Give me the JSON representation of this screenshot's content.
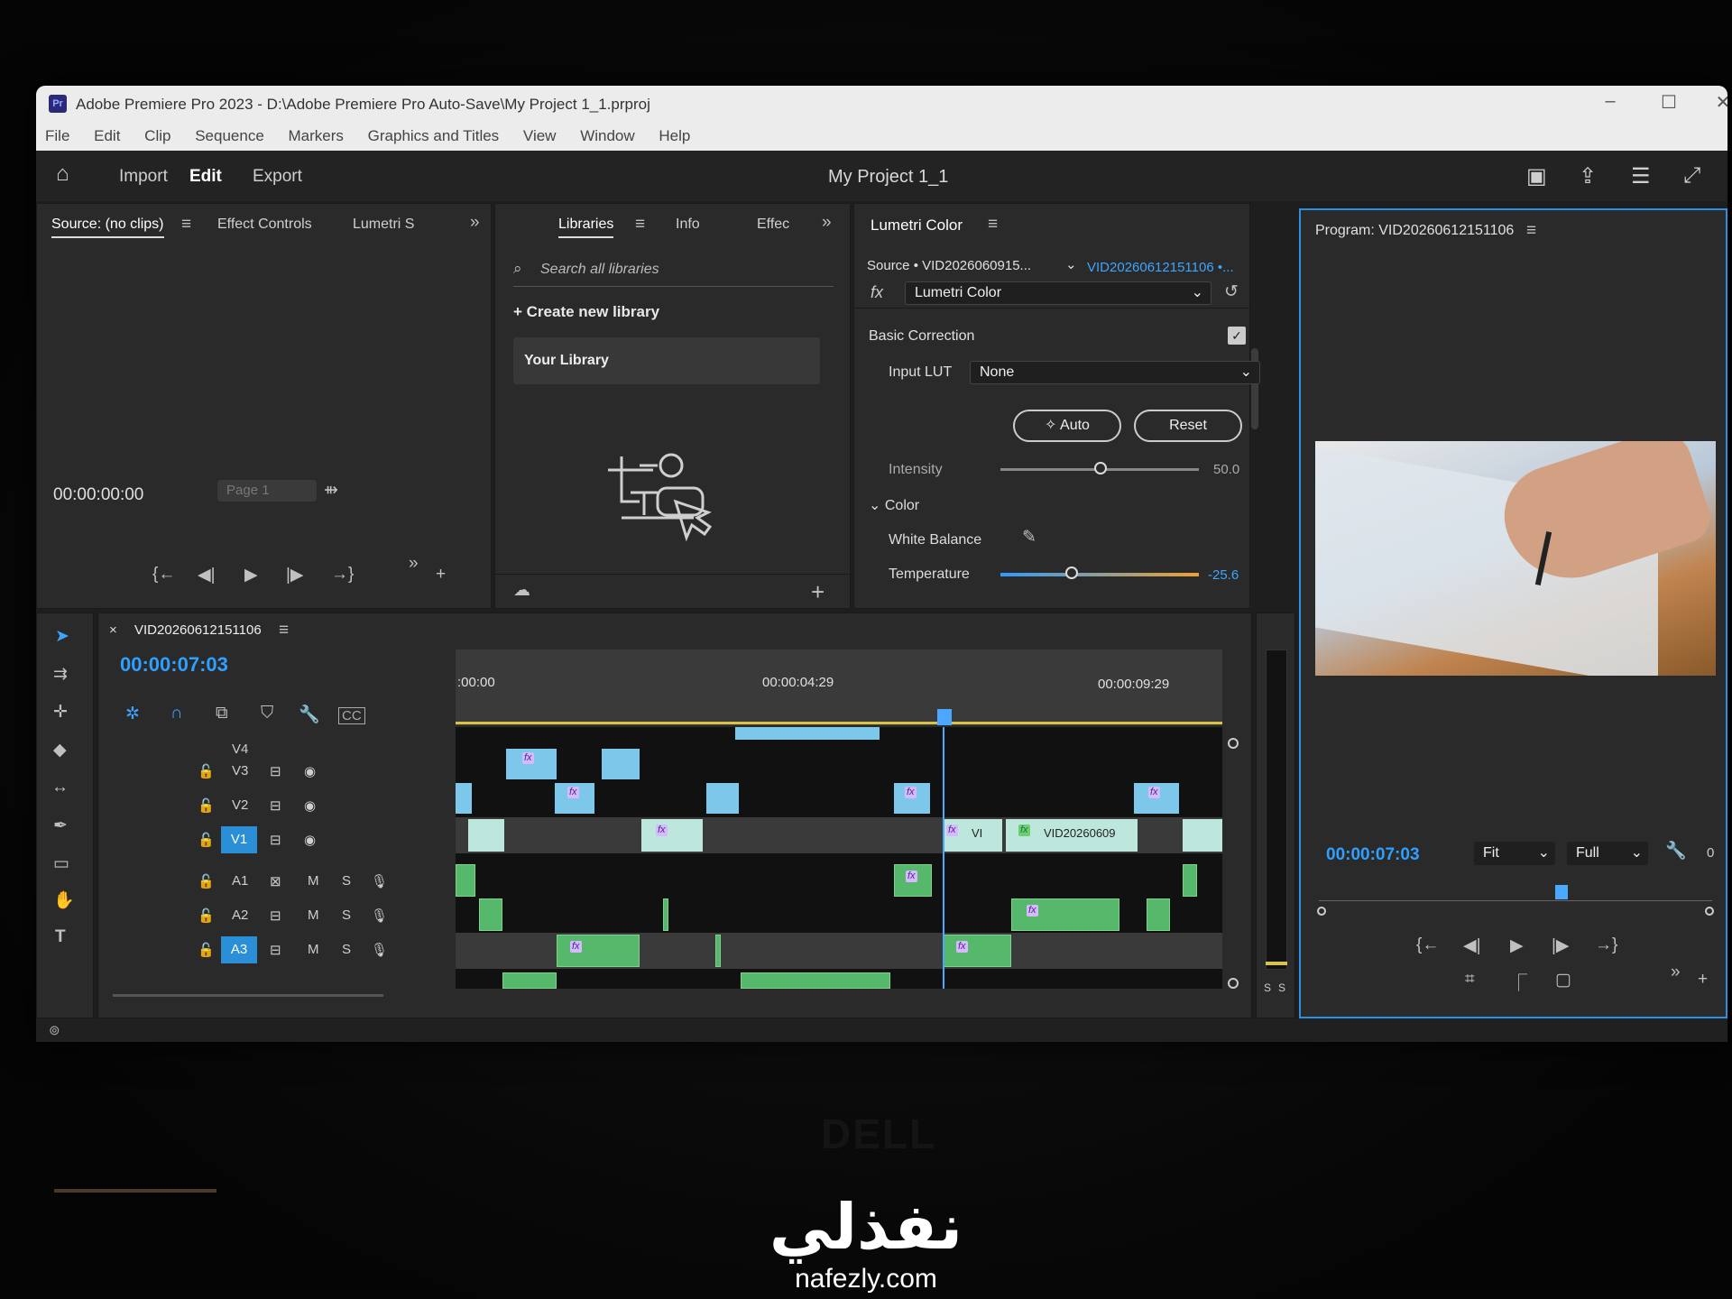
{
  "window": {
    "app_badge": "Pr",
    "title": "Adobe Premiere Pro 2023 - D:\\Adobe Premiere Pro Auto-Save\\My Project 1_1.prproj"
  },
  "menu": [
    "File",
    "Edit",
    "Clip",
    "Sequence",
    "Markers",
    "Graphics and Titles",
    "View",
    "Window",
    "Help"
  ],
  "header": {
    "home_icon": "home-icon",
    "tabs": [
      "Import",
      "Edit",
      "Export"
    ],
    "active_tab": "Edit",
    "project_title": "My Project 1_1"
  },
  "source_panel": {
    "tabs": [
      "Source: (no clips)",
      "Effect Controls",
      "Lumetri S"
    ],
    "timecode": "00:00:00:00",
    "page": "Page 1"
  },
  "libraries_panel": {
    "tabs": [
      "Libraries",
      "Info",
      "Effec"
    ],
    "search_placeholder": "Search all libraries",
    "create_label": "Create new library",
    "your_library": "Your Library"
  },
  "lumetri_panel": {
    "title": "Lumetri Color",
    "source_label": "Source • VID2026060915...",
    "clip_label": "VID20260612151106 •...",
    "fx_label": "fx",
    "effect_select": "Lumetri Color",
    "basic_correction": "Basic Correction",
    "input_lut_label": "Input LUT",
    "input_lut_value": "None",
    "auto_label": "Auto",
    "reset_label": "Reset",
    "intensity_label": "Intensity",
    "intensity_value": "50.0",
    "color_label": "Color",
    "white_balance_label": "White Balance",
    "temperature_label": "Temperature",
    "temperature_value": "-25.6"
  },
  "program_panel": {
    "title": "Program: VID20260612151106",
    "timecode": "00:00:07:03",
    "fit": "Fit",
    "full": "Full",
    "trailing": "0"
  },
  "timeline": {
    "sequence_name": "VID20260612151106",
    "timecode": "00:00:07:03",
    "ruler": [
      ":00:00",
      "00:00:04:29",
      "00:00:09:29"
    ],
    "video_tracks": [
      "V4",
      "V3",
      "V2",
      "V1"
    ],
    "audio_tracks": [
      "A1",
      "A2",
      "A3"
    ],
    "clip_labels": {
      "v1a": "VI",
      "v1b": "VID20260609"
    },
    "meter_labels": [
      "S",
      "S"
    ]
  },
  "watermark": {
    "arabic": "نفذلي",
    "site": "nafezly.com"
  },
  "brand": "DELL"
}
